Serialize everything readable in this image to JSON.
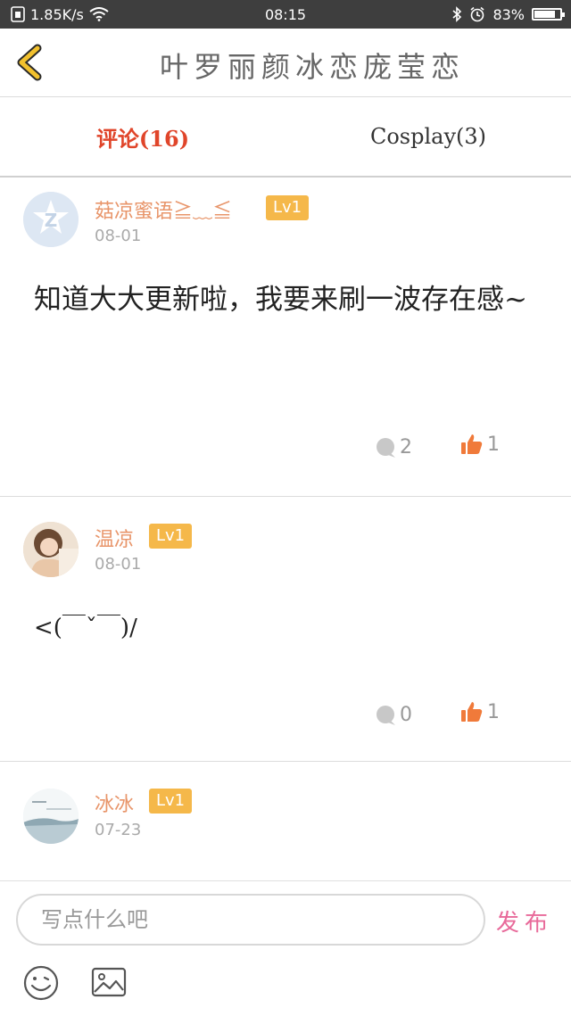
{
  "status_bar": {
    "net_speed": "1.85K/s",
    "time": "08:15",
    "battery_pct": "83%",
    "battery_level": 0.83
  },
  "header": {
    "title": "叶罗丽颜冰恋庞莹恋",
    "back_icon": "chevron-left-icon",
    "back_color": "#f2c12e"
  },
  "tabs": [
    {
      "label": "评论(16)",
      "active": true
    },
    {
      "label": "Cosplay(3)",
      "active": false
    }
  ],
  "comments": [
    {
      "username": "菇凉蜜语≧﹏≦",
      "level": "Lv1",
      "date": "08-01",
      "text": "知道大大更新啦，我要来刷一波存在感~",
      "reply_count": "2",
      "like_count": "1",
      "avatar": "default-logo-avatar"
    },
    {
      "username": "温凉",
      "level": "Lv1",
      "date": "08-01",
      "text": "<(￣ˇ￣)/",
      "reply_count": "0",
      "like_count": "1",
      "avatar": "girl-photo-avatar"
    },
    {
      "username": "冰冰",
      "level": "Lv1",
      "date": "07-23",
      "text": "",
      "avatar": "scenery-photo-avatar"
    }
  ],
  "composer": {
    "placeholder": "写点什么吧",
    "send_label": "发布",
    "emoji_icon": "smiley-icon",
    "image_icon": "image-icon"
  },
  "colors": {
    "accent_tab": "#e0452a",
    "username": "#e8956a",
    "level_badge": "#f5b84a",
    "like": "#f07a3a",
    "send": "#e86a9a"
  }
}
